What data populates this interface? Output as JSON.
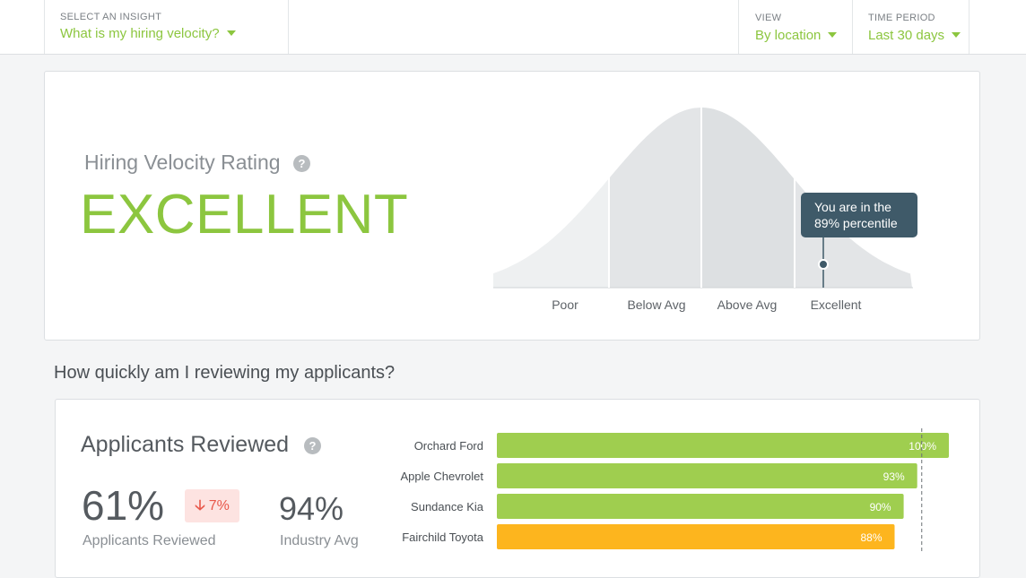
{
  "header": {
    "insight_label": "SELECT AN INSIGHT",
    "insight_value": "What is my hiring velocity?",
    "view_label": "VIEW",
    "view_value": "By location",
    "period_label": "TIME PERIOD",
    "period_value": "Last 30 days"
  },
  "rating": {
    "title": "Hiring Velocity Rating",
    "value": "EXCELLENT",
    "tooltip_line1": "You are in the",
    "tooltip_line2": "89% percentile",
    "percentile": 89,
    "bands": [
      "Poor",
      "Below Avg",
      "Above Avg",
      "Excellent"
    ]
  },
  "section": {
    "title": "How quickly am I reviewing my applicants?"
  },
  "reviewed": {
    "title": "Applicants Reviewed",
    "value": "61%",
    "value_label": "Applicants Reviewed",
    "change": "7%",
    "industry_value": "94%",
    "industry_label": "Industry Avg"
  },
  "colors": {
    "accent_green": "#8cc63f",
    "bar_green": "#9fce4f",
    "bar_orange": "#fdb51e",
    "badge_red": "#e8574a",
    "tooltip_bg": "#3f5a69"
  },
  "chart_data": {
    "type": "bar",
    "orientation": "horizontal",
    "categories": [
      "Orchard Ford",
      "Apple Chevrolet",
      "Sundance Kia",
      "Fairchild Toyota"
    ],
    "values": [
      100,
      93,
      90,
      88
    ],
    "labels": [
      "100%",
      "93%",
      "90%",
      "88%"
    ],
    "bar_colors": [
      "#9fce4f",
      "#9fce4f",
      "#9fce4f",
      "#fdb51e"
    ],
    "xlim": [
      0,
      100
    ],
    "reference_line": 94
  }
}
